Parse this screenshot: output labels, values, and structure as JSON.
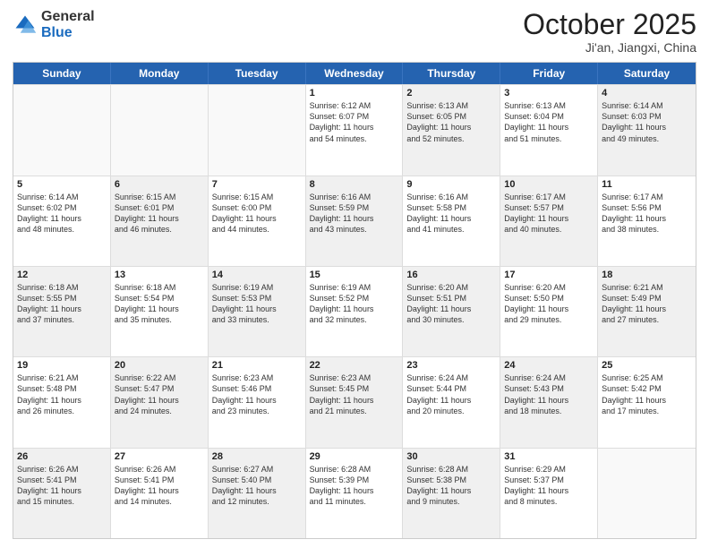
{
  "header": {
    "logo_general": "General",
    "logo_blue": "Blue",
    "month_title": "October 2025",
    "location": "Ji'an, Jiangxi, China"
  },
  "days_of_week": [
    "Sunday",
    "Monday",
    "Tuesday",
    "Wednesday",
    "Thursday",
    "Friday",
    "Saturday"
  ],
  "rows": [
    [
      {
        "day": "",
        "info": "",
        "empty": true
      },
      {
        "day": "",
        "info": "",
        "empty": true
      },
      {
        "day": "",
        "info": "",
        "empty": true
      },
      {
        "day": "1",
        "info": "Sunrise: 6:12 AM\nSunset: 6:07 PM\nDaylight: 11 hours\nand 54 minutes.",
        "empty": false,
        "shaded": false
      },
      {
        "day": "2",
        "info": "Sunrise: 6:13 AM\nSunset: 6:05 PM\nDaylight: 11 hours\nand 52 minutes.",
        "empty": false,
        "shaded": true
      },
      {
        "day": "3",
        "info": "Sunrise: 6:13 AM\nSunset: 6:04 PM\nDaylight: 11 hours\nand 51 minutes.",
        "empty": false,
        "shaded": false
      },
      {
        "day": "4",
        "info": "Sunrise: 6:14 AM\nSunset: 6:03 PM\nDaylight: 11 hours\nand 49 minutes.",
        "empty": false,
        "shaded": true
      }
    ],
    [
      {
        "day": "5",
        "info": "Sunrise: 6:14 AM\nSunset: 6:02 PM\nDaylight: 11 hours\nand 48 minutes.",
        "empty": false,
        "shaded": false
      },
      {
        "day": "6",
        "info": "Sunrise: 6:15 AM\nSunset: 6:01 PM\nDaylight: 11 hours\nand 46 minutes.",
        "empty": false,
        "shaded": true
      },
      {
        "day": "7",
        "info": "Sunrise: 6:15 AM\nSunset: 6:00 PM\nDaylight: 11 hours\nand 44 minutes.",
        "empty": false,
        "shaded": false
      },
      {
        "day": "8",
        "info": "Sunrise: 6:16 AM\nSunset: 5:59 PM\nDaylight: 11 hours\nand 43 minutes.",
        "empty": false,
        "shaded": true
      },
      {
        "day": "9",
        "info": "Sunrise: 6:16 AM\nSunset: 5:58 PM\nDaylight: 11 hours\nand 41 minutes.",
        "empty": false,
        "shaded": false
      },
      {
        "day": "10",
        "info": "Sunrise: 6:17 AM\nSunset: 5:57 PM\nDaylight: 11 hours\nand 40 minutes.",
        "empty": false,
        "shaded": true
      },
      {
        "day": "11",
        "info": "Sunrise: 6:17 AM\nSunset: 5:56 PM\nDaylight: 11 hours\nand 38 minutes.",
        "empty": false,
        "shaded": false
      }
    ],
    [
      {
        "day": "12",
        "info": "Sunrise: 6:18 AM\nSunset: 5:55 PM\nDaylight: 11 hours\nand 37 minutes.",
        "empty": false,
        "shaded": true
      },
      {
        "day": "13",
        "info": "Sunrise: 6:18 AM\nSunset: 5:54 PM\nDaylight: 11 hours\nand 35 minutes.",
        "empty": false,
        "shaded": false
      },
      {
        "day": "14",
        "info": "Sunrise: 6:19 AM\nSunset: 5:53 PM\nDaylight: 11 hours\nand 33 minutes.",
        "empty": false,
        "shaded": true
      },
      {
        "day": "15",
        "info": "Sunrise: 6:19 AM\nSunset: 5:52 PM\nDaylight: 11 hours\nand 32 minutes.",
        "empty": false,
        "shaded": false
      },
      {
        "day": "16",
        "info": "Sunrise: 6:20 AM\nSunset: 5:51 PM\nDaylight: 11 hours\nand 30 minutes.",
        "empty": false,
        "shaded": true
      },
      {
        "day": "17",
        "info": "Sunrise: 6:20 AM\nSunset: 5:50 PM\nDaylight: 11 hours\nand 29 minutes.",
        "empty": false,
        "shaded": false
      },
      {
        "day": "18",
        "info": "Sunrise: 6:21 AM\nSunset: 5:49 PM\nDaylight: 11 hours\nand 27 minutes.",
        "empty": false,
        "shaded": true
      }
    ],
    [
      {
        "day": "19",
        "info": "Sunrise: 6:21 AM\nSunset: 5:48 PM\nDaylight: 11 hours\nand 26 minutes.",
        "empty": false,
        "shaded": false
      },
      {
        "day": "20",
        "info": "Sunrise: 6:22 AM\nSunset: 5:47 PM\nDaylight: 11 hours\nand 24 minutes.",
        "empty": false,
        "shaded": true
      },
      {
        "day": "21",
        "info": "Sunrise: 6:23 AM\nSunset: 5:46 PM\nDaylight: 11 hours\nand 23 minutes.",
        "empty": false,
        "shaded": false
      },
      {
        "day": "22",
        "info": "Sunrise: 6:23 AM\nSunset: 5:45 PM\nDaylight: 11 hours\nand 21 minutes.",
        "empty": false,
        "shaded": true
      },
      {
        "day": "23",
        "info": "Sunrise: 6:24 AM\nSunset: 5:44 PM\nDaylight: 11 hours\nand 20 minutes.",
        "empty": false,
        "shaded": false
      },
      {
        "day": "24",
        "info": "Sunrise: 6:24 AM\nSunset: 5:43 PM\nDaylight: 11 hours\nand 18 minutes.",
        "empty": false,
        "shaded": true
      },
      {
        "day": "25",
        "info": "Sunrise: 6:25 AM\nSunset: 5:42 PM\nDaylight: 11 hours\nand 17 minutes.",
        "empty": false,
        "shaded": false
      }
    ],
    [
      {
        "day": "26",
        "info": "Sunrise: 6:26 AM\nSunset: 5:41 PM\nDaylight: 11 hours\nand 15 minutes.",
        "empty": false,
        "shaded": true
      },
      {
        "day": "27",
        "info": "Sunrise: 6:26 AM\nSunset: 5:41 PM\nDaylight: 11 hours\nand 14 minutes.",
        "empty": false,
        "shaded": false
      },
      {
        "day": "28",
        "info": "Sunrise: 6:27 AM\nSunset: 5:40 PM\nDaylight: 11 hours\nand 12 minutes.",
        "empty": false,
        "shaded": true
      },
      {
        "day": "29",
        "info": "Sunrise: 6:28 AM\nSunset: 5:39 PM\nDaylight: 11 hours\nand 11 minutes.",
        "empty": false,
        "shaded": false
      },
      {
        "day": "30",
        "info": "Sunrise: 6:28 AM\nSunset: 5:38 PM\nDaylight: 11 hours\nand 9 minutes.",
        "empty": false,
        "shaded": true
      },
      {
        "day": "31",
        "info": "Sunrise: 6:29 AM\nSunset: 5:37 PM\nDaylight: 11 hours\nand 8 minutes.",
        "empty": false,
        "shaded": false
      },
      {
        "day": "",
        "info": "",
        "empty": true
      }
    ]
  ]
}
